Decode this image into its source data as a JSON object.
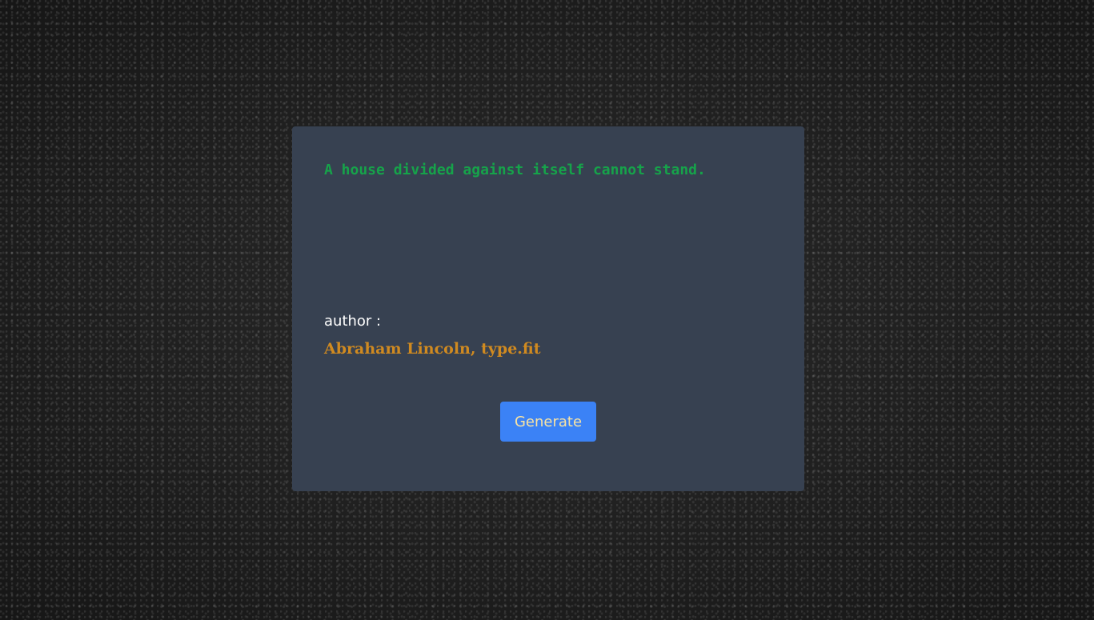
{
  "quote": {
    "text": "A house divided against itself cannot stand."
  },
  "author": {
    "label": "author :",
    "name": "Abraham Lincoln, type.fit"
  },
  "actions": {
    "generate_label": "Generate"
  },
  "colors": {
    "background": "#1b1b1b",
    "card": "#374151",
    "quote_text": "#16a34a",
    "author_label": "#ffffff",
    "author_name": "#d08a20",
    "button_bg": "#3b82f6",
    "button_text": "#f8e3a3"
  }
}
